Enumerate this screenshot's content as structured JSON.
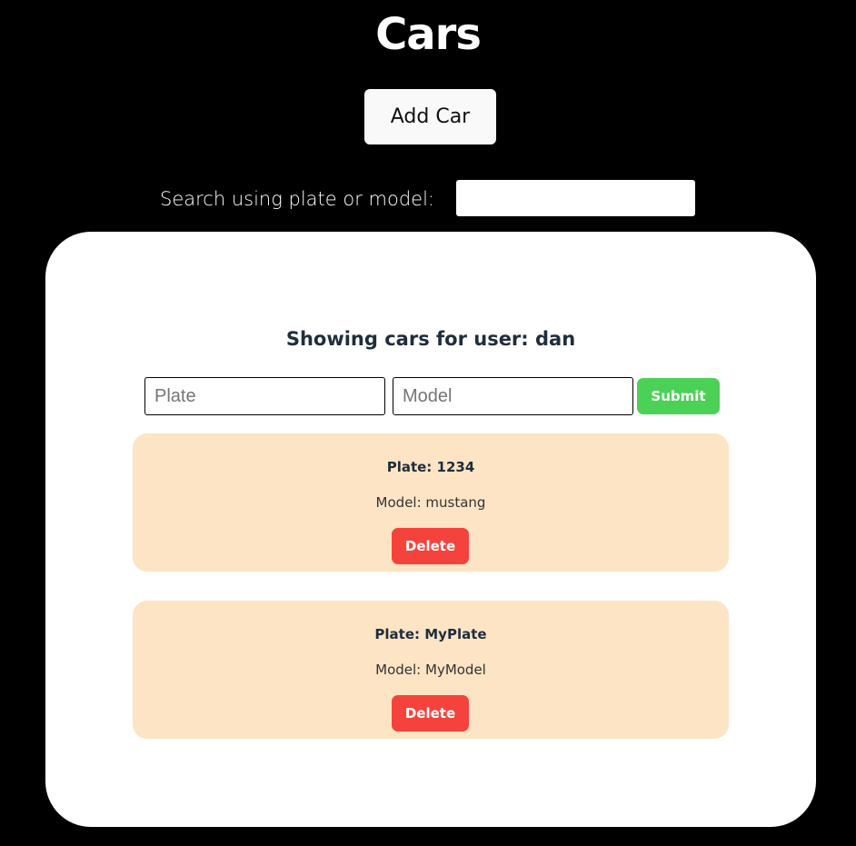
{
  "header": {
    "title": "Cars",
    "add_button_label": "Add Car"
  },
  "search": {
    "label": "Search using plate or model:",
    "value": "",
    "placeholder": ""
  },
  "panel": {
    "heading": "Showing cars for user: dan",
    "form": {
      "plate_placeholder": "Plate",
      "model_placeholder": "Model",
      "plate_value": "",
      "model_value": "",
      "submit_label": "Submit"
    },
    "cars": [
      {
        "plate": "Plate: 1234",
        "model": "Model: mustang",
        "delete_label": "Delete"
      },
      {
        "plate": "Plate: MyPlate",
        "model": "Model: MyModel",
        "delete_label": "Delete"
      }
    ]
  },
  "colors": {
    "background": "#000000",
    "card": "#ffffff",
    "car_card": "#fde4c4",
    "submit": "#4cd157",
    "delete": "#f4433c"
  }
}
